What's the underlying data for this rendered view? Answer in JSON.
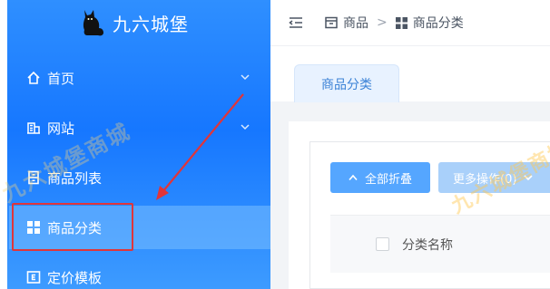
{
  "app": {
    "title": "九六城堡"
  },
  "sidebar": {
    "items": [
      {
        "label": "首页",
        "icon": "home-icon",
        "expandable": true
      },
      {
        "label": "网站",
        "icon": "website-icon",
        "expandable": true
      },
      {
        "label": "商品列表",
        "icon": "product-list-icon",
        "expandable": false
      },
      {
        "label": "商品分类",
        "icon": "grid-icon",
        "expandable": false,
        "active": true
      },
      {
        "label": "定价模板",
        "icon": "pricing-icon",
        "expandable": false
      }
    ]
  },
  "breadcrumb": {
    "items": [
      "商品",
      "商品分类"
    ],
    "separator": ">"
  },
  "tabs": [
    {
      "label": "商品分类",
      "active": true
    }
  ],
  "toolbar": {
    "collapse_all_label": "全部折叠",
    "more_actions_label": "更多操作(0)"
  },
  "table": {
    "columns": [
      "分类名称"
    ]
  },
  "watermark": "九六城堡商城",
  "colors": {
    "sidebar_bg": "#1677ff",
    "annotation_red": "#e0353a",
    "primary_button": "#55a6ff",
    "tab_active_bg": "#e8f2ff"
  }
}
